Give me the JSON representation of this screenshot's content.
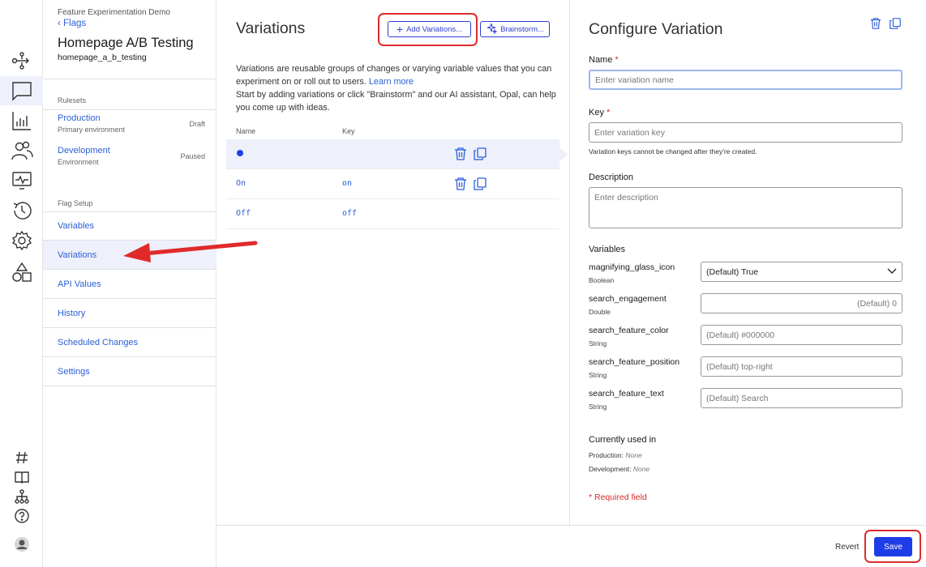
{
  "project": "Feature Experimentation Demo",
  "back_link": "Flags",
  "flag": {
    "title": "Homepage A/B Testing",
    "key": "homepage_a_b_testing"
  },
  "rulesets": {
    "label": "Rulesets",
    "items": [
      {
        "name": "Production",
        "sub": "Primary environment",
        "status": "Draft"
      },
      {
        "name": "Development",
        "sub": "Environment",
        "status": "Paused"
      }
    ]
  },
  "flag_setup": {
    "label": "Flag Setup",
    "items": [
      "Variables",
      "Variations",
      "API Values",
      "History",
      "Scheduled Changes",
      "Settings"
    ],
    "active": "Variations"
  },
  "variations": {
    "title": "Variations",
    "add_button": "Add Variations...",
    "brainstorm_button": "Brainstorm...",
    "desc_line1": "Variations are reusable groups of changes or varying variable values that you can experiment on or roll out to users.",
    "learn_more": "Learn more",
    "desc_line2": "Start by adding variations or click \"Brainstorm\" and our AI assistant, Opal, can help you come up with ideas.",
    "col_name": "Name",
    "col_key": "Key",
    "rows": [
      {
        "name": "",
        "key": ""
      },
      {
        "name": "On",
        "key": "on"
      },
      {
        "name": "Off",
        "key": "off"
      }
    ]
  },
  "configure": {
    "title": "Configure Variation",
    "name_label": "Name",
    "name_placeholder": "Enter variation name",
    "key_label": "Key",
    "key_placeholder": "Enter variation key",
    "key_hint": "Variation keys cannot be changed after they're created.",
    "desc_label": "Description",
    "desc_placeholder": "Enter description",
    "variables_label": "Variables",
    "variables": [
      {
        "name": "magnifying_glass_icon",
        "type": "Boolean",
        "value": "(Default) True"
      },
      {
        "name": "search_engagement",
        "type": "Double",
        "value": "(Default) 0"
      },
      {
        "name": "search_feature_color",
        "type": "String",
        "value": "(Default) #000000"
      },
      {
        "name": "search_feature_position",
        "type": "String",
        "value": "(Default) top-right"
      },
      {
        "name": "search_feature_text",
        "type": "String",
        "value": "(Default) Search"
      }
    ],
    "used_in_label": "Currently used in",
    "used_in": [
      {
        "env": "Production:",
        "value": "None"
      },
      {
        "env": "Development:",
        "value": "None"
      }
    ],
    "required_note": "* Required field"
  },
  "footer": {
    "revert": "Revert",
    "save": "Save"
  },
  "colors": {
    "accent": "#1f3de6",
    "link": "#2c5fd6",
    "highlight": "#e02a2a",
    "selected_bg": "#eef0fb"
  }
}
